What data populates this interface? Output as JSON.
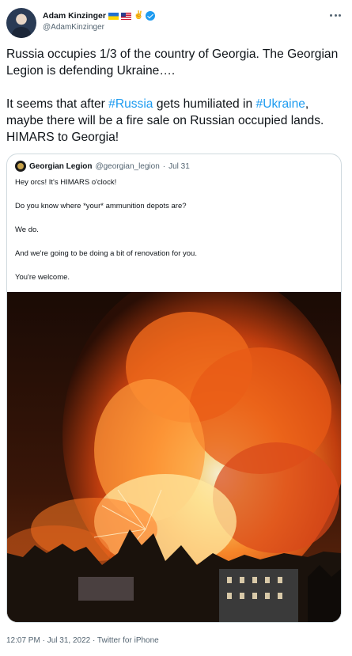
{
  "author": {
    "display_name": "Adam Kinzinger",
    "handle": "@AdamKinzinger",
    "victory_emoji": "✌️"
  },
  "tweet": {
    "line1": "Russia occupies 1/3 of the country of Georgia.  The Georgian Legion is defending Ukraine….",
    "line2_a": "It seems that after ",
    "hashtag_russia": "#Russia",
    "line2_b": " gets humiliated in ",
    "hashtag_ukraine": "#Ukraine",
    "line2_c": ", maybe there will be a fire sale on Russian occupied lands.  HIMARS to Georgia!"
  },
  "quote": {
    "name": "Georgian Legion",
    "handle": "@georgian_legion",
    "separator": "·",
    "date": "Jul 31",
    "paragraphs": [
      "Hey orcs! It's HIMARS o'clock!",
      "Do you know where *your* ammunition depots are?",
      "We do.",
      "And we're going to be doing a bit of renovation for you.",
      "You're welcome."
    ]
  },
  "footer": {
    "time": "12:07 PM",
    "separator1": " · ",
    "date": "Jul 31, 2022",
    "separator2": " · ",
    "source": "Twitter for iPhone"
  },
  "colors": {
    "link": "#1d9bf0",
    "secondary_text": "#536471",
    "border": "#cfd9de"
  }
}
